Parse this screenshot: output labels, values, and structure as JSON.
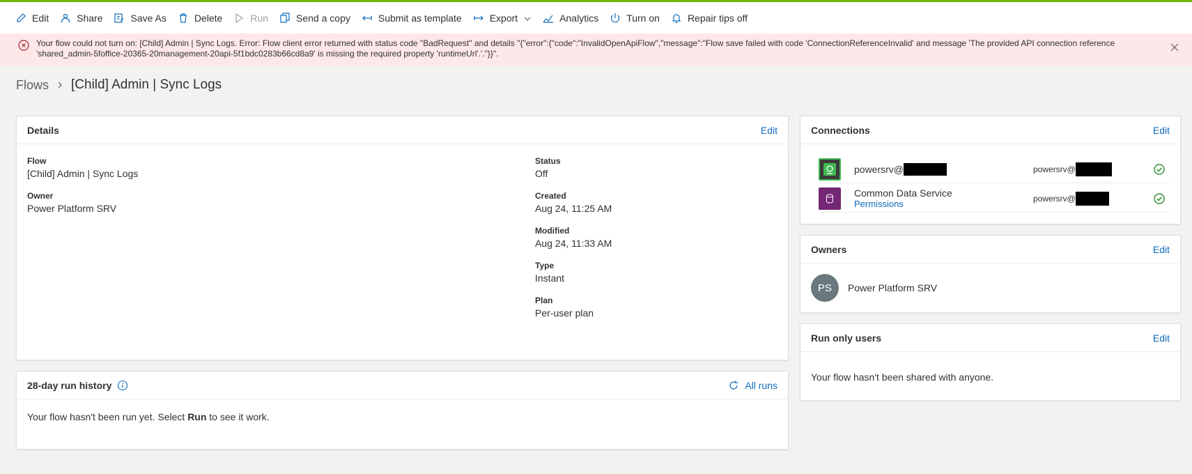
{
  "toolbar": {
    "edit": "Edit",
    "share": "Share",
    "save_as": "Save As",
    "delete": "Delete",
    "run": "Run",
    "send_copy": "Send a copy",
    "submit_template": "Submit as template",
    "export": "Export",
    "analytics": "Analytics",
    "turn_on": "Turn on",
    "repair_tips": "Repair tips off"
  },
  "banner": {
    "message": "Your flow could not turn on: [Child] Admin | Sync Logs. Error: Flow client error returned with status code \"BadRequest\" and details \"{\"error\":{\"code\":\"InvalidOpenApiFlow\",\"message\":\"Flow save failed with code 'ConnectionReferenceInvalid' and message 'The provided API connection reference 'shared_admin-5foffice-20365-20management-20api-5f1bdc0283b66cd8a9' is missing the required property 'runtimeUrl'.'.\"}}\"."
  },
  "breadcrumb": {
    "root": "Flows",
    "current": "[Child] Admin | Sync Logs"
  },
  "details": {
    "title": "Details",
    "edit": "Edit",
    "flow_label": "Flow",
    "flow_value": "[Child] Admin | Sync Logs",
    "owner_label": "Owner",
    "owner_value": "Power Platform SRV",
    "status_label": "Status",
    "status_value": "Off",
    "created_label": "Created",
    "created_value": "Aug 24, 11:25 AM",
    "modified_label": "Modified",
    "modified_value": "Aug 24, 11:33 AM",
    "type_label": "Type",
    "type_value": "Instant",
    "plan_label": "Plan",
    "plan_value": "Per-user plan"
  },
  "run_history": {
    "title": "28-day run history",
    "all_runs": "All runs",
    "empty_prefix": "Your flow hasn't been run yet. Select ",
    "empty_bold": "Run",
    "empty_suffix": " to see it work."
  },
  "connections": {
    "title": "Connections",
    "edit": "Edit",
    "items": [
      {
        "name": "powersrv@",
        "account": "powersrv@",
        "icon": "office365-admin-icon",
        "color": "#3fb950"
      },
      {
        "name": "Common Data Service",
        "link": "Permissions",
        "account": "powersrv@",
        "icon": "database-icon",
        "color": "#742774"
      }
    ]
  },
  "owners": {
    "title": "Owners",
    "edit": "Edit",
    "initials": "PS",
    "name": "Power Platform SRV"
  },
  "run_only": {
    "title": "Run only users",
    "edit": "Edit",
    "empty": "Your flow hasn't been shared with anyone."
  },
  "colors": {
    "accent": "#0f6cbd",
    "success": "#107c10",
    "error_bg": "#fde7e9",
    "top_bar": "#6bb700"
  }
}
